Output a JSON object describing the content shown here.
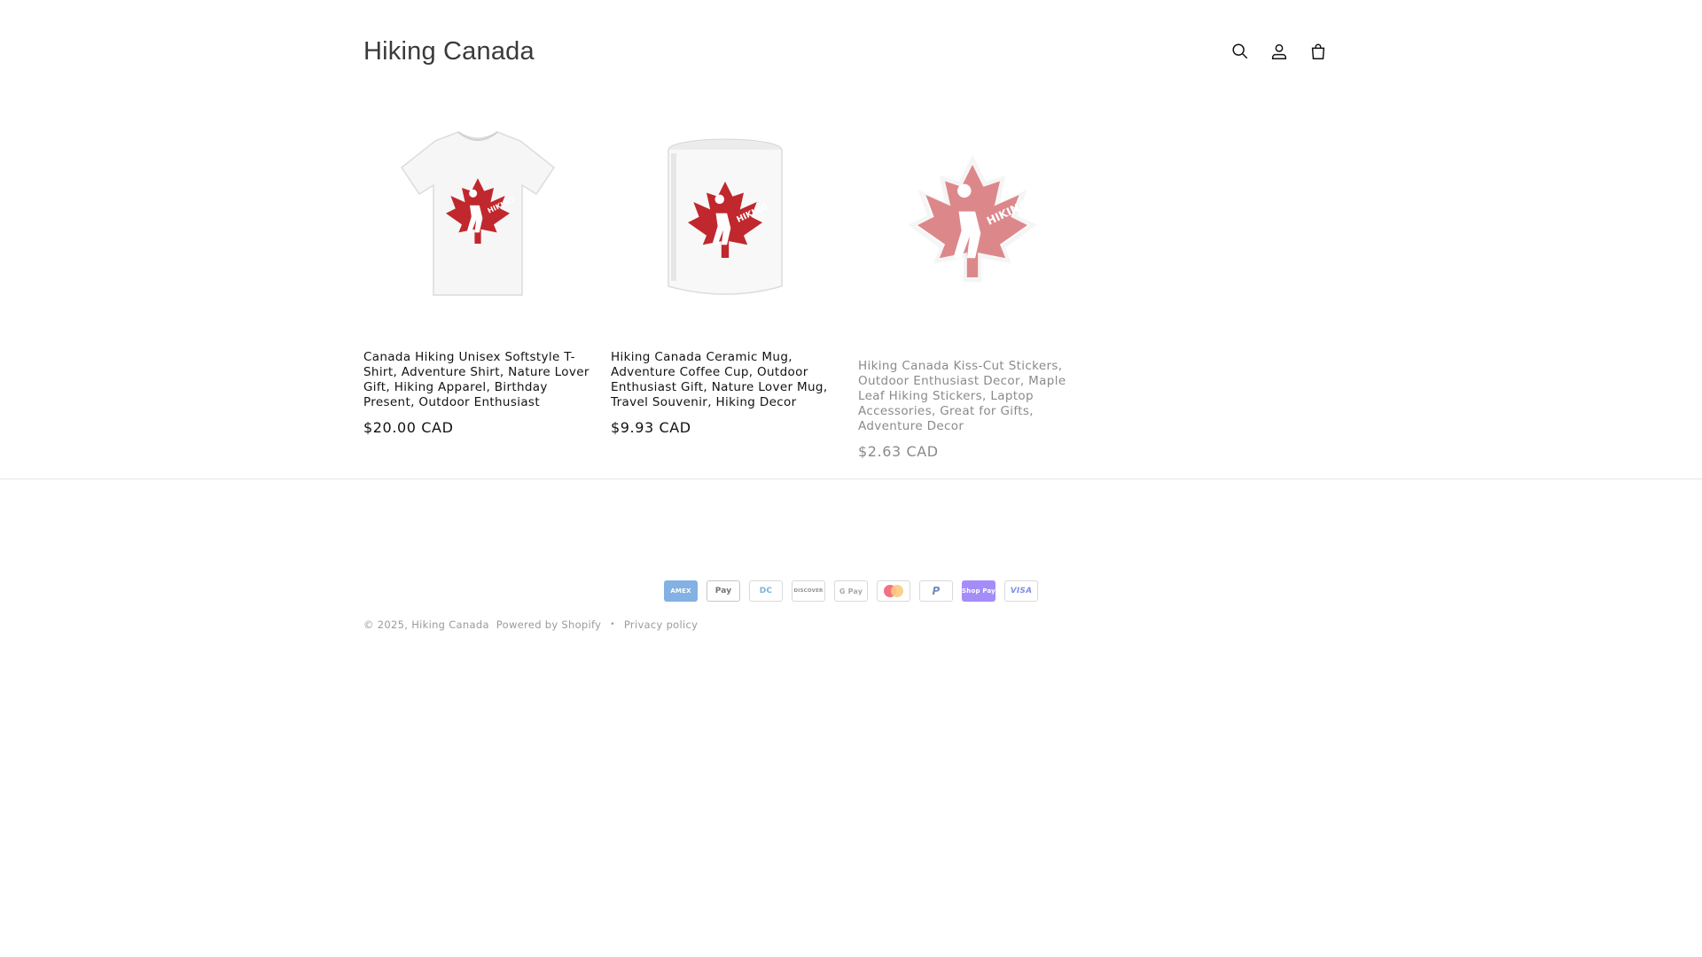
{
  "header": {
    "brand": "Hiking Canada",
    "icons": [
      "search-icon",
      "account-icon",
      "cart-icon"
    ]
  },
  "products": [
    {
      "title": "Canada Hiking Unisex Softstyle T-Shirt, Adventure Shirt, Nature Lover Gift, Hiking Apparel, Birthday Present, Outdoor Enthusiast",
      "price": "$20.00 CAD",
      "image": "tshirt-image"
    },
    {
      "title": "Hiking Canada Ceramic Mug, Adventure Coffee Cup, Outdoor Enthusiast Gift, Nature Lover Mug, Travel Souvenir, Hiking Decor",
      "price": "$9.93 CAD",
      "image": "mug-image"
    },
    {
      "title": "Hiking Canada Kiss-Cut Stickers, Outdoor Enthusiast Decor, Maple Leaf Hiking Stickers, Laptop Accessories, Great for Gifts, Adventure Decor",
      "price": "$2.63 CAD",
      "image": "sticker-image"
    }
  ],
  "colors": {
    "accent_red": "#c0282d",
    "text": "#121212",
    "muted": "#8a8a8a"
  },
  "footer": {
    "payment_methods": [
      "American Express",
      "Apple Pay",
      "Diners Club",
      "Discover",
      "Google Pay",
      "Mastercard",
      "PayPal",
      "Shop Pay",
      "Visa"
    ],
    "payment_labels": {
      "amex": "AMEX",
      "apple": "Pay",
      "diners": "DC",
      "discover": "DISCOVER",
      "google": "G Pay",
      "mastercard": "MC",
      "paypal": "P",
      "shop": "Shop Pay",
      "visa": "VISA"
    },
    "copyright_prefix": "© 2025,",
    "store_link": "Hiking Canada",
    "powered_by": "Powered by Shopify",
    "privacy_policy": "Privacy policy"
  }
}
